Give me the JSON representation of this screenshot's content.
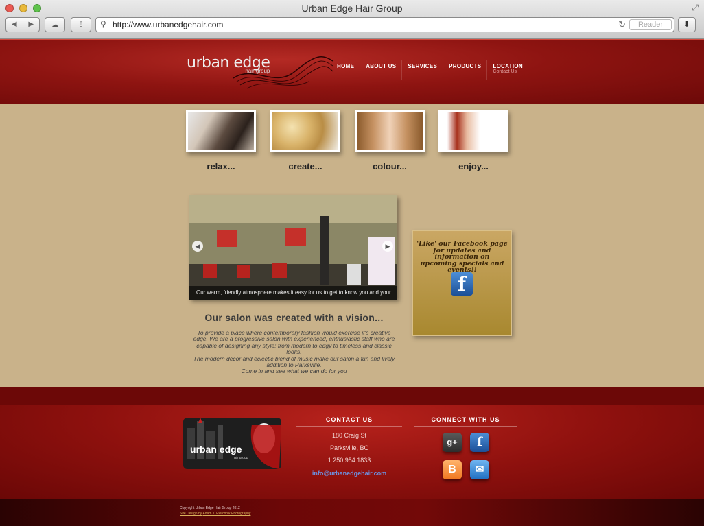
{
  "browser": {
    "window_title": "Urban Edge Hair Group",
    "url": "http://www.urbanedgehair.com",
    "reader_label": "Reader"
  },
  "header": {
    "logo_main": "urban edge",
    "logo_sub": "hair group",
    "nav": [
      {
        "label": "HOME",
        "sub": ""
      },
      {
        "label": "ABOUT US",
        "sub": ""
      },
      {
        "label": "SERVICES",
        "sub": ""
      },
      {
        "label": "PRODUCTS",
        "sub": ""
      },
      {
        "label": "LOCATION",
        "sub": "Contact Us"
      }
    ]
  },
  "thumbnails": [
    {
      "caption": "relax..."
    },
    {
      "caption": "create..."
    },
    {
      "caption": "colour..."
    },
    {
      "caption": "enjoy..."
    }
  ],
  "slideshow": {
    "caption": "Our warm, friendly atmosphere makes it easy for us to get to know you and your hair"
  },
  "vision": {
    "title": "Our salon was created with a vision...",
    "paragraphs": [
      "To provide a place where contemporary fashion would exercise it's creative edge. We are a progressive salon with experienced, enthusiastic staff who are capable of designing any style: from modern to edgy to timeless and classic looks.",
      "The modern décor and eclectic blend of music make our salon a fun and lively addition to Parksville.",
      "Come in and see what we can do for you"
    ]
  },
  "facebook_box": {
    "text": "'Like' our Facebook page for updates and information on upcoming specials and events!!"
  },
  "footer": {
    "logo_text": "urban edge",
    "logo_sub": "hair group",
    "contact_heading": "CONTACT US",
    "address_line1": "180 Craig St",
    "address_line2": "Parksville, BC",
    "phone": "1.250.954.1833",
    "email": "info@urbanedgehair.com",
    "connect_heading": "CONNECT WITH US",
    "copyright": "Copyright Urban Edge Hair Group 2012",
    "site_design_prefix": "Site Design by",
    "site_design_link": "Adam J. Pierchnik Photography"
  }
}
